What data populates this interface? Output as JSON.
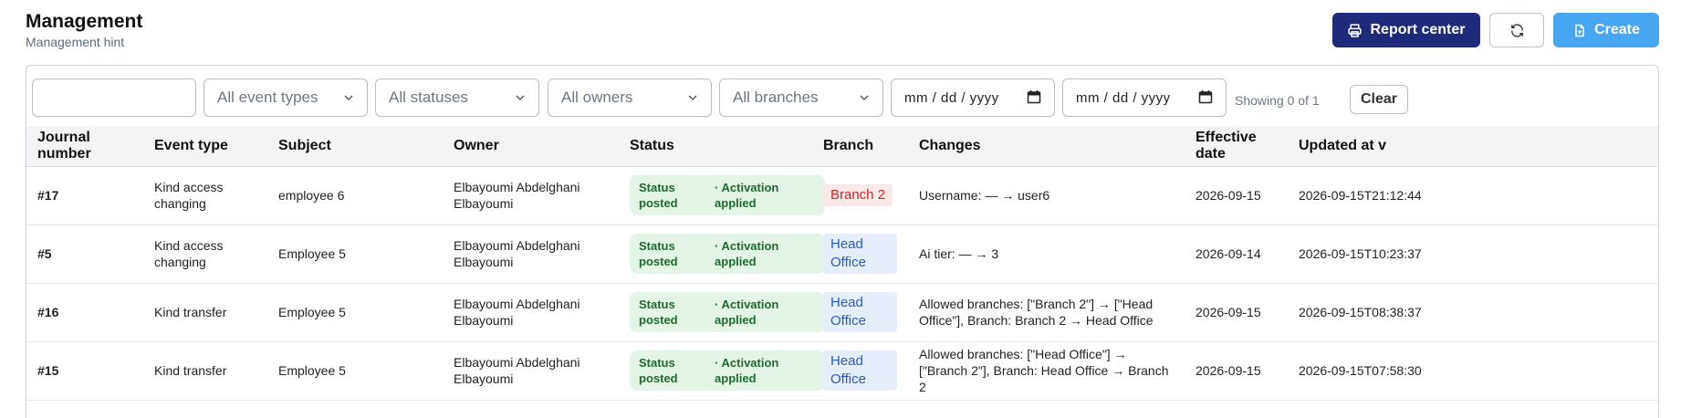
{
  "header": {
    "title": "Management",
    "hint": "Management hint"
  },
  "actions": {
    "report_label": "Report center",
    "create_label": "Create"
  },
  "filters": {
    "search_value": "",
    "event_type": "All event types",
    "status": "All statuses",
    "owner": "All owners",
    "branch": "All branches",
    "date_from": "mm / dd / yyyy",
    "date_to": "mm / dd / yyyy",
    "showing": "Showing 0 of 1",
    "clear_label": "Clear"
  },
  "table": {
    "columns": [
      "Journal number",
      "Event type",
      "Subject",
      "Owner",
      "Status",
      "Branch",
      "Changes",
      "Effective date",
      "Updated at v"
    ],
    "rows": [
      {
        "journal": "#17",
        "event": "Kind access changing",
        "subject": "employee 6",
        "owner": "Elbayoumi Abdelghani Elbayoumi",
        "status1": "Status posted",
        "status2": "· Activation applied",
        "branch": "Branch 2",
        "branch_color": "#c62828",
        "changes": "Username: — → user6",
        "effective": "2026-09-15",
        "updated": "2026-09-15T21:12:44"
      },
      {
        "journal": "#5",
        "event": "Kind access changing",
        "subject": "Employee 5",
        "owner": "Elbayoumi Abdelghani Elbayoumi",
        "status1": "Status posted",
        "status2": "· Activation applied",
        "branch": "Head Office",
        "branch_color": "#2a5bb8",
        "changes": "Ai tier: — → 3",
        "effective": "2026-09-14",
        "updated": "2026-09-15T10:23:37"
      },
      {
        "journal": "#16",
        "event": "Kind transfer",
        "subject": "Employee 5",
        "owner": "Elbayoumi Abdelghani Elbayoumi",
        "status1": "Status posted",
        "status2": "· Activation applied",
        "branch": "Head Office",
        "branch_color": "#2a5bb8",
        "changes": "Allowed branches: [\"Branch 2\"] → [\"Head Office\"], Branch: Branch 2 → Head Office",
        "effective": "2026-09-15",
        "updated": "2026-09-15T08:38:37"
      },
      {
        "journal": "#15",
        "event": "Kind transfer",
        "subject": "Employee 5",
        "owner": "Elbayoumi Abdelghani Elbayoumi",
        "status1": "Status posted",
        "status2": "· Activation applied",
        "branch": "Head Office",
        "branch_color": "#2a5bb8",
        "changes": "Allowed branches: [\"Head Office\"] → [\"Branch 2\"], Branch: Head Office → Branch 2",
        "effective": "2026-09-15",
        "updated": "2026-09-15T07:58:30"
      }
    ]
  },
  "colors": {
    "primary": "#1f2b7a",
    "accent": "#48a7f0",
    "status_bg": "#e4f4e6",
    "status_text": "#1e6b2e"
  },
  "icons": {
    "report": "printer-icon",
    "refresh": "refresh-icon",
    "create": "document-plus-icon",
    "chevron": "chevron-down-icon",
    "calendar": "calendar-icon"
  }
}
